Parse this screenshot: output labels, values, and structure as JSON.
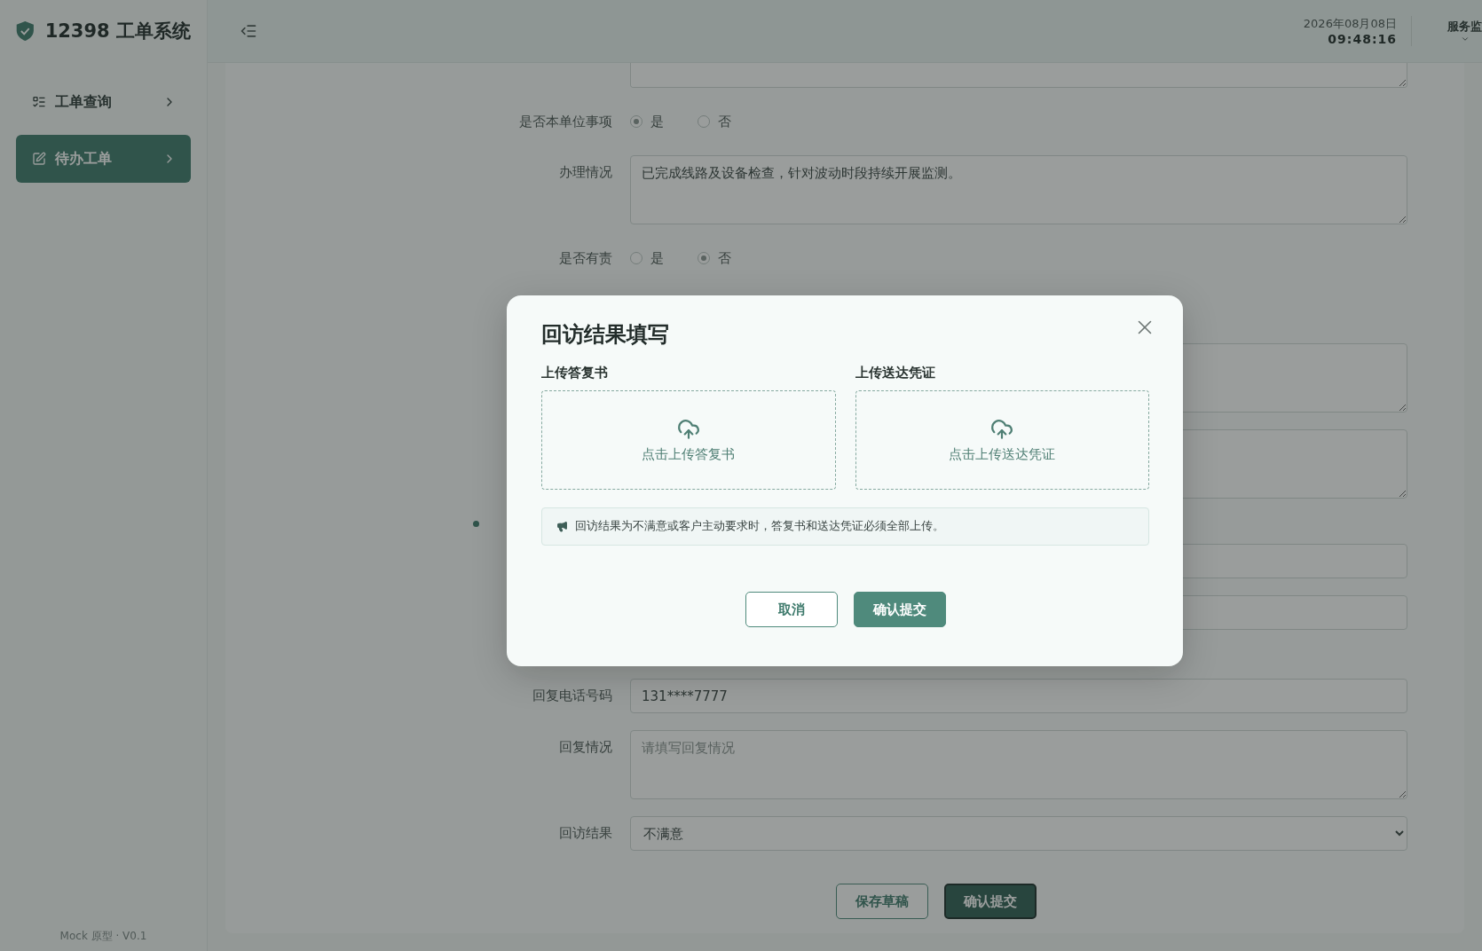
{
  "sidebar": {
    "logo": "12398 工单系统",
    "items": [
      {
        "label": "工单查询",
        "selected": false
      },
      {
        "label": "待办工单",
        "selected": true
      }
    ],
    "footer": "Mock 原型 · V0.1"
  },
  "header": {
    "date": "2026年08月08日",
    "time": "09:48:16",
    "user": "服务监"
  },
  "form": {
    "fields": [
      {
        "kind": "textarea"
      },
      {
        "kind": "radio",
        "label": "是否本单位事项",
        "options": [
          {
            "label": "是",
            "selected": true
          },
          {
            "label": "否",
            "selected": false
          }
        ]
      },
      {
        "kind": "textarea",
        "label": "办理情况",
        "value": "已完成线路及设备检查，针对波动时段持续开展监测。"
      },
      {
        "kind": "radio",
        "label": "是否有责",
        "options": [
          {
            "label": "是",
            "selected": false
          },
          {
            "label": "否",
            "selected": true
          }
        ]
      },
      {
        "kind": "textarea"
      },
      {
        "kind": "textarea"
      },
      {
        "kind": "section"
      },
      {
        "kind": "input"
      },
      {
        "kind": "input"
      },
      {
        "kind": "input",
        "label": "回复电话号码",
        "value": "131****7777"
      },
      {
        "kind": "textarea",
        "label": "回复情况",
        "placeholder": "请填写回复情况"
      },
      {
        "kind": "select",
        "label": "回访结果",
        "value": "不满意"
      }
    ],
    "actions": [
      {
        "label": "保存草稿",
        "kind": "secondary"
      },
      {
        "label": "确认提交",
        "kind": "primary"
      }
    ]
  },
  "modal": {
    "title": "回访结果填写",
    "uploads": [
      {
        "label": "上传答复书",
        "hint": "点击上传答复书"
      },
      {
        "label": "上传送达凭证",
        "hint": "点击上传送达凭证"
      }
    ],
    "notice": "回访结果为不满意或客户主动要求时，答复书和送达凭证必须全部上传。",
    "buttons": [
      {
        "label": "取消",
        "kind": "secondary"
      },
      {
        "label": "确认提交",
        "kind": "primary"
      }
    ]
  }
}
